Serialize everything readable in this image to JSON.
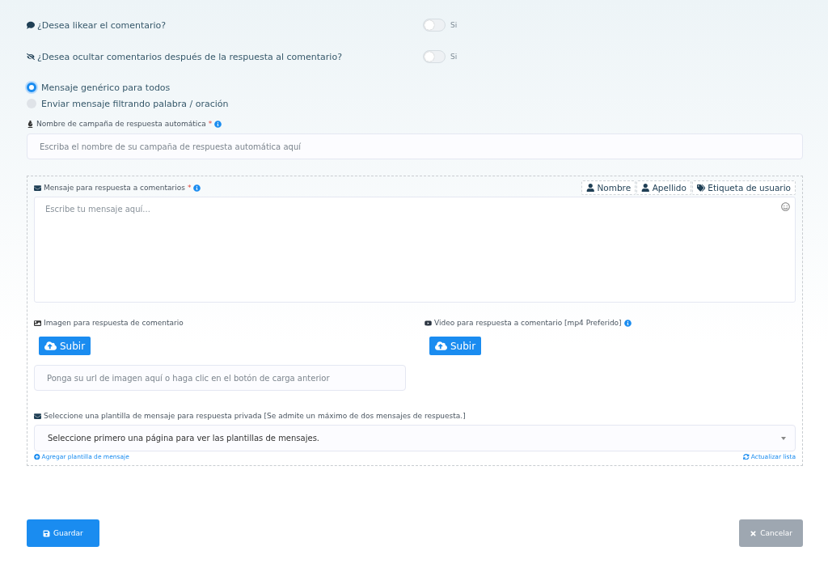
{
  "toggles": [
    {
      "label": "¿Desea likear el comentario?",
      "on": false,
      "state_label": "Si"
    },
    {
      "label": "¿Desea ocultar comentarios después de la respuesta al comentario?",
      "on": false,
      "state_label": "Si"
    }
  ],
  "radios": [
    {
      "label": "Mensaje genérico para todos",
      "selected": true
    },
    {
      "label": "Enviar mensaje filtrando palabra / oración",
      "selected": false
    }
  ],
  "campaign": {
    "label": "Nombre de campaña de respuesta automática",
    "required": "*",
    "placeholder": "Escriba el nombre de su campaña de respuesta automática aquí"
  },
  "message": {
    "label": "Mensaje para respuesta a comentarios",
    "required": "*",
    "placeholder": "Escribe tu mensaje aquí...",
    "tags": [
      "Nombre",
      "Apellido",
      "Etiqueta de usuario"
    ]
  },
  "image": {
    "label": "Imagen para respuesta de comentario",
    "button": "Subir",
    "placeholder": "Ponga su url de imagen aquí o haga clic en el botón de carga anterior"
  },
  "video": {
    "label": "Video para respuesta a comentario [mp4 Preferido]",
    "button": "Subir"
  },
  "template": {
    "label": "Seleccione una plantilla de mensaje para respuesta privada [Se admite un máximo de dos mensajes de respuesta.]",
    "value": "Seleccione primero una página para ver las plantillas de mensajes.",
    "add_link": "Agregar plantilla de mensaje",
    "refresh_link": "Actualizar lista"
  },
  "buttons": {
    "save": "Guardar",
    "cancel": "Cancelar"
  }
}
